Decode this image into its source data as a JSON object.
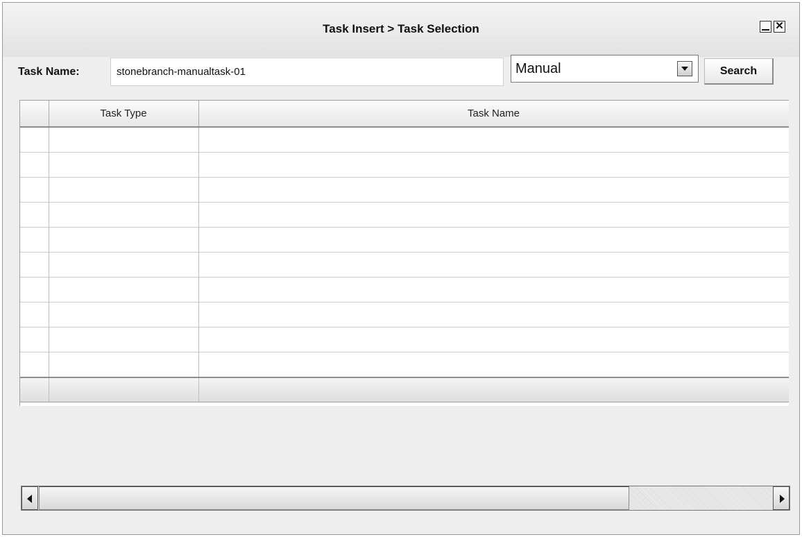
{
  "window": {
    "title": "Task Insert > Task Selection",
    "minimize_glyph": "",
    "close_glyph": "✕"
  },
  "filter": {
    "task_name_label": "Task Name:",
    "task_name_value": "stonebranch-manualtask-01",
    "task_type_selected": "Manual",
    "search_label": "Search"
  },
  "table": {
    "columns": [
      "",
      "Task Type",
      "Task Name"
    ],
    "rows": [
      [
        "",
        "",
        ""
      ],
      [
        "",
        "",
        ""
      ],
      [
        "",
        "",
        ""
      ],
      [
        "",
        "",
        ""
      ],
      [
        "",
        "",
        ""
      ],
      [
        "",
        "",
        ""
      ],
      [
        "",
        "",
        ""
      ],
      [
        "",
        "",
        ""
      ],
      [
        "",
        "",
        ""
      ],
      [
        "",
        "",
        ""
      ]
    ]
  },
  "icons": {
    "minimize": "minimize-icon",
    "close": "close-icon",
    "dropdown": "chevron-down-icon",
    "scroll_left": "arrow-left-icon",
    "scroll_right": "arrow-right-icon"
  }
}
